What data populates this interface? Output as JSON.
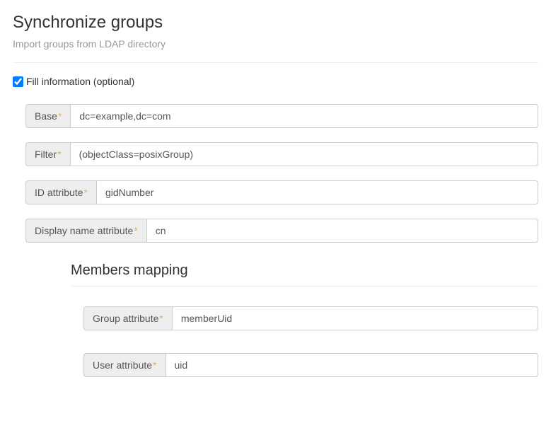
{
  "header": {
    "title": "Synchronize groups",
    "subtitle": "Import groups from LDAP directory"
  },
  "fillInfo": {
    "label": "Fill information (optional)",
    "checked": true
  },
  "requiredMark": "*",
  "fields": {
    "base": {
      "label": "Base",
      "value": "dc=example,dc=com"
    },
    "filter": {
      "label": "Filter",
      "value": "(objectClass=posixGroup)"
    },
    "idAttribute": {
      "label": "ID attribute",
      "value": "gidNumber"
    },
    "displayNameAttribute": {
      "label": "Display name attribute",
      "value": "cn"
    }
  },
  "membersMapping": {
    "title": "Members mapping",
    "fields": {
      "groupAttribute": {
        "label": "Group attribute",
        "value": "memberUid"
      },
      "userAttribute": {
        "label": "User attribute",
        "value": "uid"
      }
    }
  }
}
